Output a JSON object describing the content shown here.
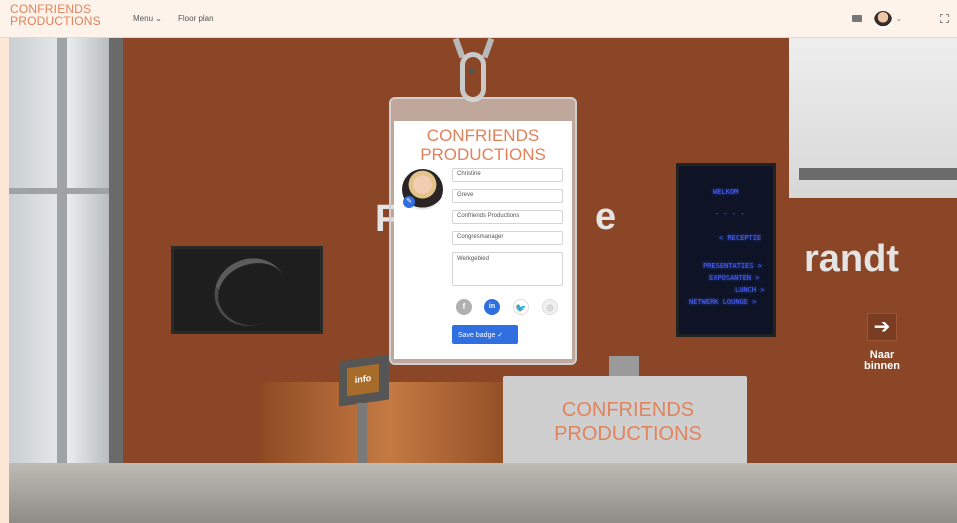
{
  "header": {
    "logo_line1": "CONFRIENDS",
    "logo_line2": "PRODUCTIONS",
    "menu_label": "Menu ⌄",
    "floor_plan_label": "Floor plan",
    "avatar_caret": "⌄"
  },
  "scene": {
    "wall_text_left": "F",
    "wall_text_mid": "e",
    "wall_text_right": "randt",
    "signage": {
      "lines": [
        "WELKOM",
        "- - - -",
        "< RECEPTIE",
        "PRESENTATIES >",
        "EXPOSANTEN >",
        "LUNCH >",
        "NETWERK LOUNGE >"
      ]
    },
    "arrow_icon": "➔",
    "naar_line1": "Naar",
    "naar_line2": "binnen",
    "desk_line1": "CONFRIENDS",
    "desk_line2": "PRODUCTIONS",
    "info_label": "info"
  },
  "badge": {
    "title_line1": "CONFRIENDS",
    "title_line2": "PRODUCTIONS",
    "fields": {
      "first_name": "Christine",
      "last_name": "Greve",
      "company": "Confriends Productions",
      "job_title": "Congresmanager",
      "bio": "Werkgebied"
    },
    "social_icons": [
      "facebook-icon",
      "linkedin-icon",
      "twitter-icon",
      "instagram-icon"
    ],
    "save_label": "Save badge ✓"
  },
  "colors": {
    "brand": "#e0825a",
    "primary": "#2f6fe0",
    "wall": "#8a4627"
  }
}
